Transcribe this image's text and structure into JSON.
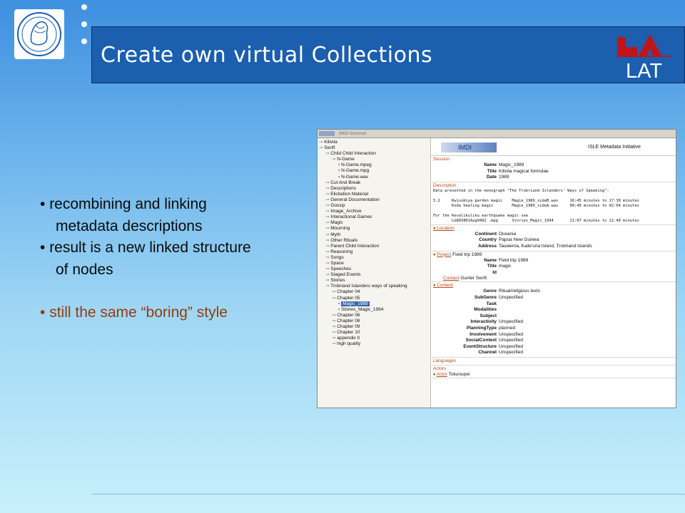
{
  "header": {
    "title": "Create own virtual Collections",
    "lat_logo_text": "LAT",
    "lat_color": "#c0141a"
  },
  "bullets": [
    {
      "line1": "recombining and linking",
      "line2": "metadata descriptions"
    },
    {
      "line1": "result is a new linked structure",
      "line2": "of nodes"
    },
    {
      "line1": "still the same “boring” style",
      "highlight": true
    }
  ],
  "browser": {
    "window_title": "IMDI-browser",
    "tree": [
      {
        "level": 0,
        "label": "Kilivila"
      },
      {
        "level": 0,
        "label": "Senft"
      },
      {
        "level": 1,
        "label": "Child Child Interaction"
      },
      {
        "level": 2,
        "label": "N-Game"
      },
      {
        "level": 3,
        "label": "N-Game.mpeg"
      },
      {
        "level": 3,
        "label": "N-Game.mpg"
      },
      {
        "level": 3,
        "label": "N-Game.wav"
      },
      {
        "level": 1,
        "label": "Cut And Break"
      },
      {
        "level": 1,
        "label": "Descriptions"
      },
      {
        "level": 1,
        "label": "Elicitation Material"
      },
      {
        "level": 1,
        "label": "General Documentation"
      },
      {
        "level": 1,
        "label": "Gossip"
      },
      {
        "level": 1,
        "label": "Image_Archive"
      },
      {
        "level": 1,
        "label": "Interactional Games"
      },
      {
        "level": 1,
        "label": "Magic"
      },
      {
        "level": 1,
        "label": "Mourning"
      },
      {
        "level": 1,
        "label": "Myth"
      },
      {
        "level": 1,
        "label": "Other Rituals"
      },
      {
        "level": 1,
        "label": "Parent Child Interaction"
      },
      {
        "level": 1,
        "label": "Reasoning"
      },
      {
        "level": 1,
        "label": "Songs"
      },
      {
        "level": 1,
        "label": "Space"
      },
      {
        "level": 1,
        "label": "Speeches"
      },
      {
        "level": 1,
        "label": "Staged Events"
      },
      {
        "level": 1,
        "label": "Stories"
      },
      {
        "level": 1,
        "label": "Trobriand Islanders ways of speaking"
      },
      {
        "level": 2,
        "label": "Chapter 04"
      },
      {
        "level": 2,
        "label": "Chapter 05"
      },
      {
        "level": 3,
        "label": "Magic_1989",
        "selected": true
      },
      {
        "level": 3,
        "label": "Stories_Magic_1994"
      },
      {
        "level": 2,
        "label": "Chapter 06"
      },
      {
        "level": 2,
        "label": "Chapter 08"
      },
      {
        "level": 2,
        "label": "Chapter 09"
      },
      {
        "level": 2,
        "label": "Chapter 10"
      },
      {
        "level": 2,
        "label": "appendix II"
      },
      {
        "level": 2,
        "label": "high quality"
      }
    ],
    "imdi_label": "IMDI",
    "isle_label": "ISLE Metadata Initiative",
    "session": {
      "section": "Session",
      "rows": [
        [
          "Name",
          "Magic_1989"
        ],
        [
          "Title",
          "Kilivila magical formulae"
        ],
        [
          "Date",
          "1989"
        ]
      ]
    },
    "description": {
      "section": "Description",
      "text": "Data presented in the monograph \"The Trobriand Islanders' Ways of Speaking\":\n\n5.2     Kwisubiya garden magic    Magie_1989_sideB.wav     16:45 minutes to 17:30 minutes\n        Koda healing magic        Magie_1989_sideA.wav     00:40 minutes to 02:04 minutes\n\nFor the Kevalikuliku earthquake magic see\n        LG88V801Aug9402 .mpg      Stories_Magic_1994       21:07 minutes to 22.40 minutes"
    },
    "location": {
      "section": "Location",
      "rows": [
        [
          "Continent",
          "Oceania"
        ],
        [
          "Country",
          "Papua New Guinea"
        ],
        [
          "Address",
          "Tauwema, Kaile'una Island, Trobriand Islands"
        ]
      ]
    },
    "project": {
      "section": "Project",
      "value": "Field trip 1989",
      "rows": [
        [
          "Name",
          "Field trip 1989"
        ],
        [
          "Title",
          "magic"
        ],
        [
          "Id",
          ""
        ]
      ],
      "contact_label": "Contact",
      "contact_value": "Gunter Senft"
    },
    "content": {
      "section": "Content",
      "rows": [
        [
          "Genre",
          "Ritual/religious texts"
        ],
        [
          "SubGenre",
          "Unspecified"
        ],
        [
          "Task",
          ""
        ],
        [
          "Modalities",
          ""
        ],
        [
          "Subject",
          ""
        ],
        [
          "Interactivity",
          "Unspecified"
        ],
        [
          "PlanningType",
          "planned"
        ],
        [
          "Involvement",
          "Unspecified"
        ],
        [
          "SocialContext",
          "Unspecified"
        ],
        [
          "EventStructure",
          "Unspecified"
        ],
        [
          "Channel",
          "Unspecified"
        ]
      ]
    },
    "languages": {
      "section": "Languages"
    },
    "actors": {
      "section": "Actors",
      "actor_label": "Actor",
      "actor_value": "Tokunupei"
    }
  }
}
